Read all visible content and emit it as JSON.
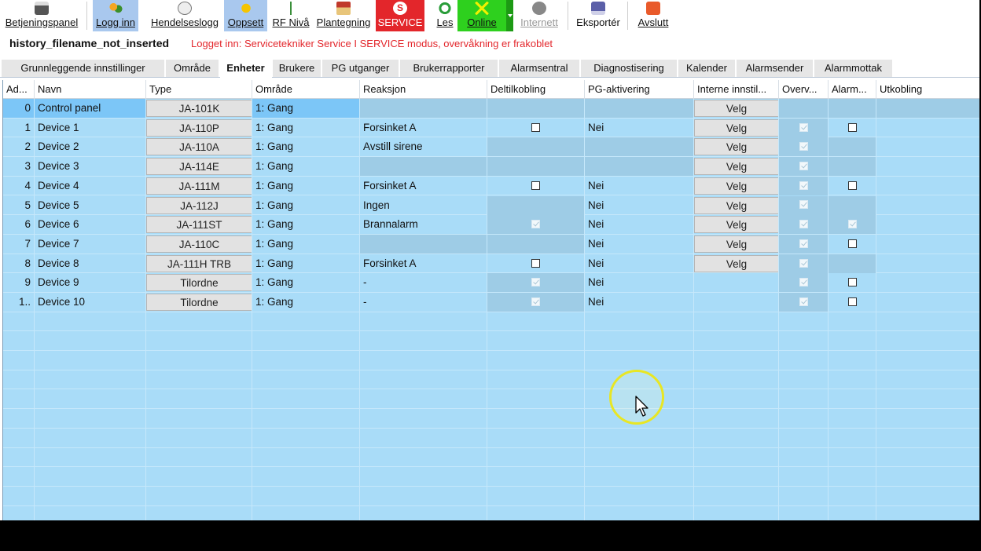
{
  "toolbar": {
    "items": [
      {
        "label": "Betjeningspanel",
        "icon": "control-panel-icon"
      },
      {
        "label": "Logg inn",
        "icon": "users-login-icon"
      },
      {
        "label": "Hendelseslogg",
        "icon": "event-log-icon"
      },
      {
        "label": "Oppsett",
        "icon": "setup-wrench-icon"
      },
      {
        "label": "RF Nivå",
        "icon": "rf-antenna-icon"
      },
      {
        "label": "Plantegning",
        "icon": "house-icon"
      },
      {
        "label": "SERVICE",
        "icon": "service-s-icon"
      },
      {
        "label": "Les",
        "icon": "refresh-icon"
      },
      {
        "label": "Online",
        "icon": "online-disconnect-icon"
      },
      {
        "label": "Internett",
        "icon": "internet-globe-icon"
      },
      {
        "label": "Eksportér",
        "icon": "save-disk-icon"
      },
      {
        "label": "Avslutt",
        "icon": "power-off-icon"
      }
    ]
  },
  "status": {
    "filename": "history_filename_not_inserted",
    "login_message": "Logget inn: Servicetekniker Service I SERVICE modus, overvåkning er frakoblet"
  },
  "tabs": [
    "Grunnleggende innstillinger",
    "Område",
    "Enheter",
    "Brukere",
    "PG utganger",
    "Brukerrapporter",
    "Alarmsentral",
    "Diagnostisering",
    "Kalender",
    "Alarmsender",
    "Alarmmottak"
  ],
  "active_tab": "Enheter",
  "grid": {
    "columns": [
      "Ad...",
      "Navn",
      "Type",
      "Område",
      "Reaksjon",
      "Deltilkobling",
      "PG-aktivering",
      "Interne innstil...",
      "Overv...",
      "Alarm...",
      "Utkobling"
    ],
    "rows": [
      {
        "addr": "0",
        "name": "Control panel",
        "type": "JA-101K",
        "area": "1: Gang",
        "reaction": "",
        "partial": "none",
        "pg": "",
        "internal": "Velg",
        "overv": "none",
        "alarm": "none"
      },
      {
        "addr": "1",
        "name": "Device 1",
        "type": "JA-110P",
        "area": "1: Gang",
        "reaction": "Forsinket A",
        "partial": "box",
        "pg": "Nei",
        "internal": "Velg",
        "overv": "dis",
        "alarm": "box"
      },
      {
        "addr": "2",
        "name": "Device 2",
        "type": "JA-110A",
        "area": "1: Gang",
        "reaction": "Avstill sirene",
        "partial": "none",
        "pg": "",
        "internal": "Velg",
        "overv": "dis",
        "alarm": "none"
      },
      {
        "addr": "3",
        "name": "Device 3",
        "type": "JA-114E",
        "area": "1: Gang",
        "reaction": "",
        "partial": "none",
        "pg": "",
        "internal": "Velg",
        "overv": "dis",
        "alarm": "none"
      },
      {
        "addr": "4",
        "name": "Device 4",
        "type": "JA-111M",
        "area": "1: Gang",
        "reaction": "Forsinket A",
        "partial": "box",
        "pg": "Nei",
        "internal": "Velg",
        "overv": "dis",
        "alarm": "box"
      },
      {
        "addr": "5",
        "name": "Device 5",
        "type": "JA-112J",
        "area": "1: Gang",
        "reaction": "Ingen",
        "partial": "none",
        "pg": "Nei",
        "internal": "Velg",
        "overv": "dis",
        "alarm": "none"
      },
      {
        "addr": "6",
        "name": "Device 6",
        "type": "JA-111ST",
        "area": "1: Gang",
        "reaction": "Brannalarm",
        "partial": "dis",
        "pg": "Nei",
        "internal": "Velg",
        "overv": "dis",
        "alarm": "dis"
      },
      {
        "addr": "7",
        "name": "Device 7",
        "type": "JA-110C",
        "area": "1: Gang",
        "reaction": "",
        "partial": "none",
        "pg": "Nei",
        "internal": "Velg",
        "overv": "dis",
        "alarm": "box"
      },
      {
        "addr": "8",
        "name": "Device 8",
        "type": "JA-111H TRB",
        "area": "1: Gang",
        "reaction": "Forsinket A",
        "partial": "box",
        "pg": "Nei",
        "internal": "Velg",
        "overv": "dis",
        "alarm": "none"
      },
      {
        "addr": "9",
        "name": "Device 9",
        "type": "Tilordne",
        "area": "1: Gang",
        "reaction": "-",
        "partial": "dis",
        "pg": "Nei",
        "internal": "",
        "overv": "dis",
        "alarm": "box"
      },
      {
        "addr": "1..",
        "name": "Device 10",
        "type": "Tilordne",
        "area": "1: Gang",
        "reaction": "-",
        "partial": "dis",
        "pg": "Nei",
        "internal": "",
        "overv": "dis",
        "alarm": "box"
      }
    ]
  },
  "colors": {
    "grid_bg": "#a9dcf8",
    "service_red": "#e3262b",
    "online_green": "#2ed01e",
    "selected_blue": "#a9c8ee"
  }
}
